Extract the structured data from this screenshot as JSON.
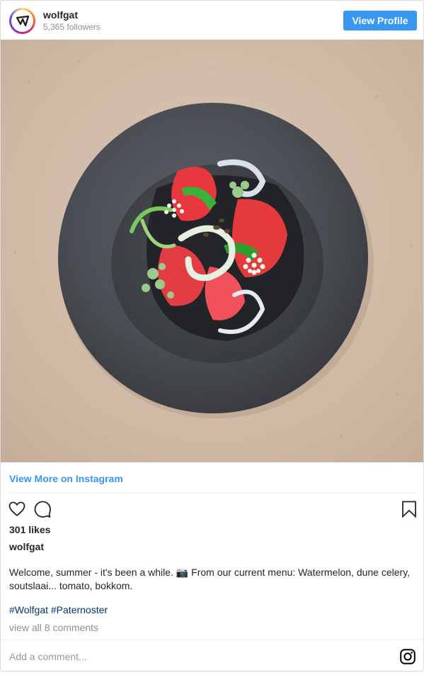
{
  "header": {
    "account_name": "wolfgat",
    "followers": "5,365 followers",
    "view_profile_label": "View Profile"
  },
  "post": {
    "photo_alt": "",
    "view_more_label": "View More on Instagram",
    "likes": "301 likes",
    "caption_user": "wolfgat",
    "caption_text": "Welcome, summer - it's been a while. 📷 From our current menu: Watermelon, dune celery, soutslaai... tomato, bokkom.",
    "hashtags": [
      "#Wolfgat",
      "#Paternoster"
    ],
    "view_comments_label": "view all 8 comments"
  },
  "comment_bar": {
    "placeholder": "Add a comment..."
  },
  "icons": {
    "like": "heart-icon",
    "comment": "comment-icon",
    "save": "bookmark-icon",
    "brand": "instagram-icon"
  },
  "colors": {
    "accent": "#3897f0",
    "hashtag": "#003569",
    "muted": "#8e8e8e"
  }
}
